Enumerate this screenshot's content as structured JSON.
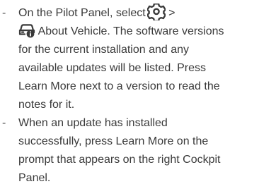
{
  "steps": [
    {
      "bullet": "-",
      "text_before_icon": "On the Pilot Panel, select",
      "icon_settings": "gear-icon",
      "separator": " >",
      "icon_vehicle": "car-info-icon",
      "text_after_icon": " About Vehicle. The software versions for the current installation and any available updates will be listed. Press Learn More next to a version to read the notes for it."
    },
    {
      "bullet": "-",
      "text": "When an update has installed successfully, press Learn More on the prompt that appears on the right Cockpit Panel."
    }
  ]
}
